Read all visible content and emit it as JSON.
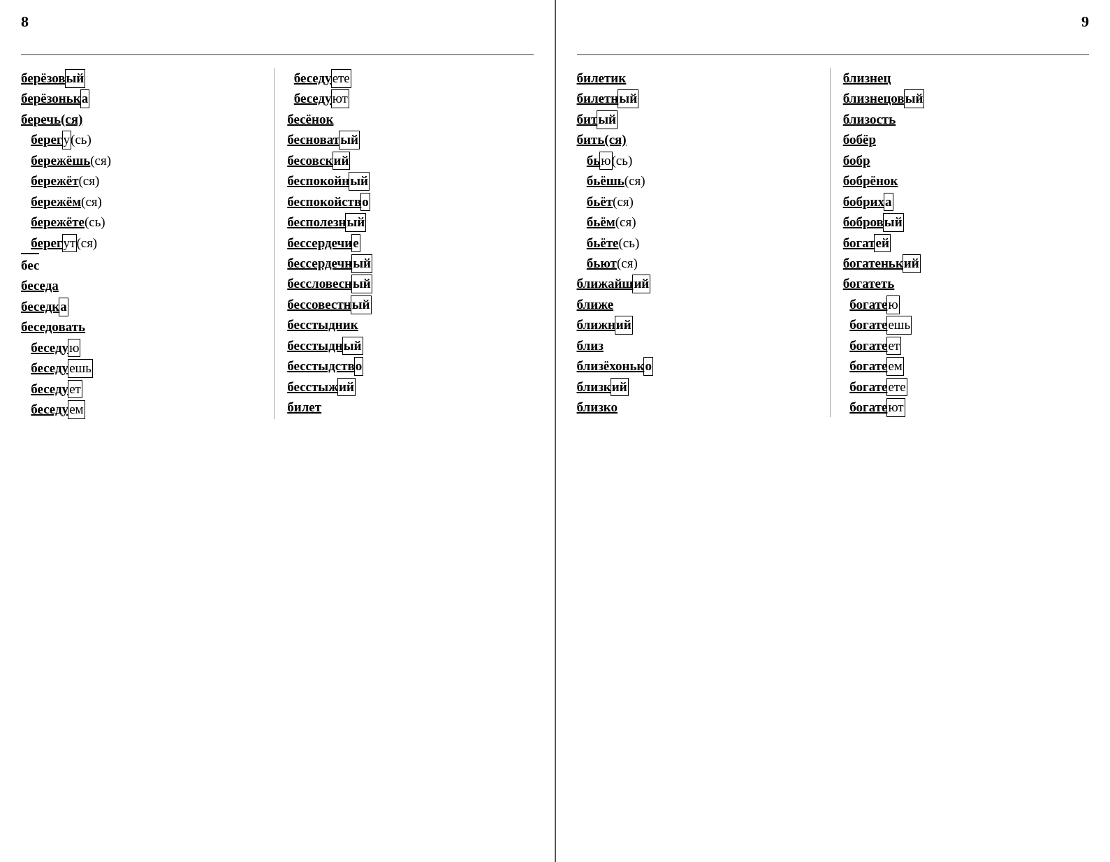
{
  "leftPage": {
    "number": "8",
    "col1": [
      "берёзов|ый",
      "берёзоньк|а",
      "беречь(ся)",
      "берег|у|(сь)",
      "бережёшь|(ся)",
      "бережёт|(ся)",
      "бережём|(ся)",
      "бережёте|(сь)",
      "берег|ут|(ся)",
      "бес",
      "беседа",
      "беседк|а",
      "беседовать",
      "беседую",
      "беседуешь",
      "беседует",
      "беседуем"
    ],
    "col2": [
      "беседуете",
      "беседуют",
      "бесёнок",
      "бесноватый",
      "бесовский",
      "беспокойный",
      "беспокойство",
      "бесполезный",
      "бессердечие",
      "бессердечный",
      "бессловесный",
      "бессовестный",
      "бесстыдник",
      "бесстыдный",
      "бесстыдство",
      "бесстыжий",
      "билет"
    ]
  },
  "rightPage": {
    "number": "9",
    "col1": [
      "билетик",
      "билетный",
      "битый",
      "бить(ся)",
      "бью|(сь)",
      "бьёшь|(ся)",
      "бьёт|(ся)",
      "бьём|(ся)",
      "бьёте|(сь)",
      "бьют|(ся)",
      "ближайший",
      "ближе",
      "ближний",
      "близ",
      "близёхонько",
      "близкий",
      "близко"
    ],
    "col2": [
      "близнец",
      "близнецовый",
      "близость",
      "бобёр",
      "бобр",
      "бобрёнок",
      "бобриха",
      "бобровый",
      "богатей",
      "богатенький",
      "богатеть",
      "богатею",
      "богатеешь",
      "богатеет",
      "богатеем",
      "богатеете",
      "богатеют"
    ]
  }
}
